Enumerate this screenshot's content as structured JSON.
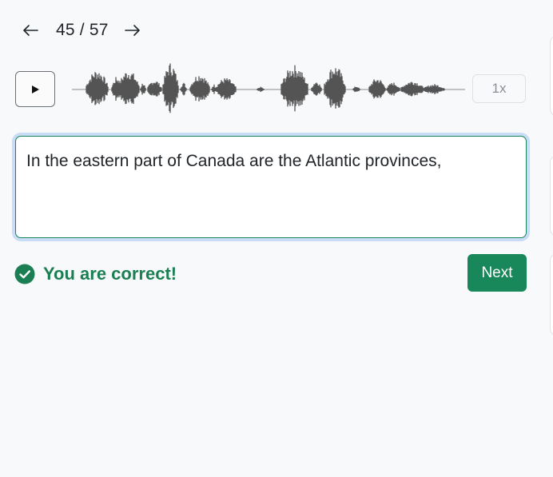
{
  "pager": {
    "prev_icon": "arrow-left-icon",
    "next_icon": "arrow-right-icon",
    "count": "45 / 57"
  },
  "audio": {
    "play_icon": "play-icon",
    "speed_label": "1x"
  },
  "answer": {
    "value": "In the eastern part of Canada are the Atlantic provinces,"
  },
  "result": {
    "icon": "check-circle-icon",
    "message": "You are correct!"
  },
  "actions": {
    "next_label": "Next"
  },
  "colors": {
    "accent_green": "#18875a",
    "success_text": "#1b7f53",
    "focus_ring": "#c9dcf5",
    "waveform": "#555555"
  }
}
